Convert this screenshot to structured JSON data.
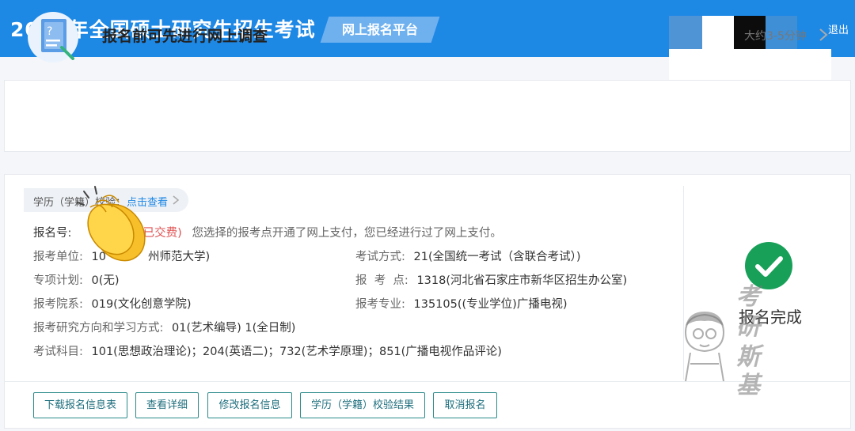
{
  "header": {
    "title": "2021年全国硕士研究生招生考试",
    "platform": "网上报名平台",
    "logout": "退出"
  },
  "survey": {
    "title": "报名前可先进行网上调查",
    "time": "大约3-5分钟"
  },
  "verification": {
    "label": "学历（学籍）校验：",
    "link": "点击查看"
  },
  "registration": {
    "number_label": "报名号:",
    "paid_status": "(已交费)",
    "payment_note": "您选择的报考点开通了网上支付，您已经进行过了网上支付。",
    "rows": [
      {
        "label": "报考单位:",
        "value": "10",
        "value_suffix": "州师范大学)"
      },
      {
        "label": "考试方式:",
        "value": "21(全国统一考试（含联合考试）)"
      },
      {
        "label": "专项计划:",
        "value": "0(无)"
      },
      {
        "label": "报  考  点:",
        "value": "1318(河北省石家庄市新华区招生办公室)"
      },
      {
        "label": "报考院系:",
        "value": "019(文化创意学院)"
      },
      {
        "label": "报考专业:",
        "value": "135105((专业学位)广播电视)"
      },
      {
        "label": "报考研究方向和学习方式:",
        "value": "01(艺术编导) 1(全日制)"
      },
      {
        "label": "考试科目:",
        "value": "101(思想政治理论)；204(英语二)；732(艺术学原理)；851(广播电视作品评论)"
      }
    ]
  },
  "status": {
    "label": "报名完成"
  },
  "actions": [
    {
      "label": "下载报名信息表"
    },
    {
      "label": "查看详细"
    },
    {
      "label": "修改报名信息"
    },
    {
      "label": "学历（学籍）校验结果"
    },
    {
      "label": "取消报名"
    }
  ],
  "watermark": {
    "chars": [
      "考",
      "研",
      "斯",
      "基"
    ]
  },
  "colors": {
    "header_bg": "#1e88e5",
    "success": "#18a058",
    "paid": "#e05252",
    "button_border": "#2b8a8a"
  }
}
